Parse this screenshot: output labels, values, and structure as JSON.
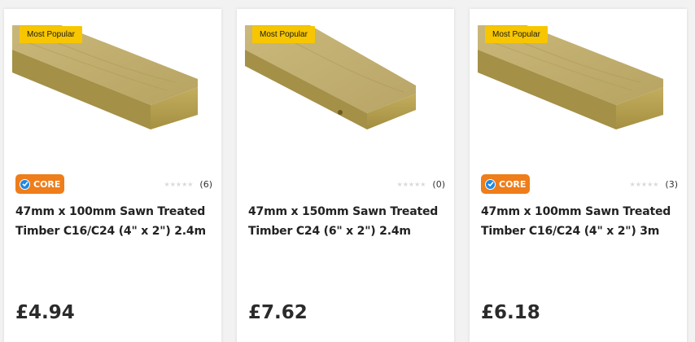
{
  "colors": {
    "popular_badge": "#f7c600",
    "core_badge": "#ee7d1a",
    "core_check": "#1e88e5",
    "star_empty": "#d9d9d9"
  },
  "products": [
    {
      "badge": "Most Popular",
      "core_label": "CORE",
      "has_core": true,
      "rating": 0,
      "reviews": "(6)",
      "title": "47mm x 100mm Sawn Treated Timber C16/C24 (4\" x 2\") 2.4m",
      "price": "£4.94",
      "image_icon": "timber-plank-icon"
    },
    {
      "badge": "Most Popular",
      "has_core": false,
      "rating": 0,
      "reviews": "(0)",
      "title": "47mm x 150mm Sawn Treated Timber C24 (6\" x 2\") 2.4m",
      "price": "£7.62",
      "image_icon": "timber-plank-icon"
    },
    {
      "badge": "Most Popular",
      "core_label": "CORE",
      "has_core": true,
      "rating": 0,
      "reviews": "(3)",
      "title": "47mm x 100mm Sawn Treated Timber C16/C24 (4\" x 2\") 3m",
      "price": "£6.18",
      "image_icon": "timber-plank-icon"
    }
  ]
}
